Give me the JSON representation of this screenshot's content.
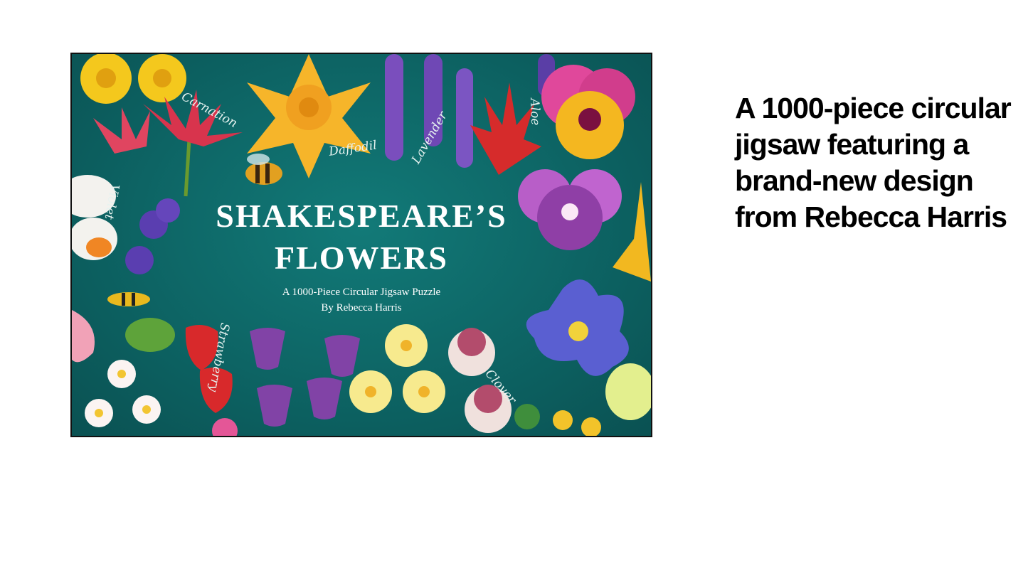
{
  "cover": {
    "title_line1": "SHAKESPEARE’S",
    "title_line2": "FLOWERS",
    "subtitle": "A 1000-Piece Circular Jigsaw Puzzle",
    "author": "By Rebecca Harris",
    "flower_labels": {
      "carnation": "Carnation",
      "daffodil": "Daffodil",
      "lavender": "Lavender",
      "aloe": "Aloe",
      "violet": "Violet",
      "strawberry": "Strawberry",
      "clover": "Clover"
    }
  },
  "caption": "A 1000-piece circular jigsaw featuring a brand-new design from Rebecca Harris",
  "colors": {
    "cover_background": "#0d6464",
    "caption_text": "#000000"
  }
}
